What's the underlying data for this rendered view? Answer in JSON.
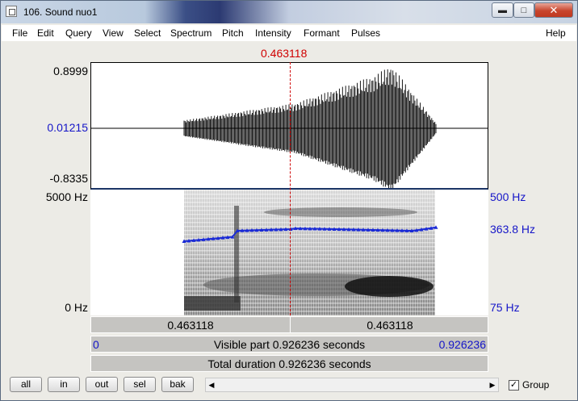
{
  "window": {
    "title": "106. Sound nuo1"
  },
  "menu": [
    "File",
    "Edit",
    "Query",
    "View",
    "Select",
    "Spectrum",
    "Pitch",
    "Intensity",
    "Formant",
    "Pulses",
    "Help"
  ],
  "cursor_time": "0.463118",
  "waveform": {
    "y_max": "0.8999",
    "y_mid": "0.01215",
    "y_min": "-0.8335"
  },
  "spectrogram": {
    "left_top": "5000 Hz",
    "left_bottom": "0 Hz",
    "right_top": "500 Hz",
    "right_mid": "363.8 Hz",
    "right_bottom": "75 Hz"
  },
  "bars": {
    "left_time": "0.463118",
    "right_time": "0.463118",
    "visible_start": "0",
    "visible_part": "Visible part 0.926236 seconds",
    "visible_end": "0.926236",
    "total": "Total duration 0.926236 seconds"
  },
  "toolbar": {
    "buttons": [
      "all",
      "in",
      "out",
      "sel",
      "bak"
    ],
    "group_label": "Group",
    "group_checked": true
  },
  "colors": {
    "pitch_line": "#1a2ad6",
    "cursor": "#d00000",
    "axis_label_blue": "#1515c8"
  }
}
